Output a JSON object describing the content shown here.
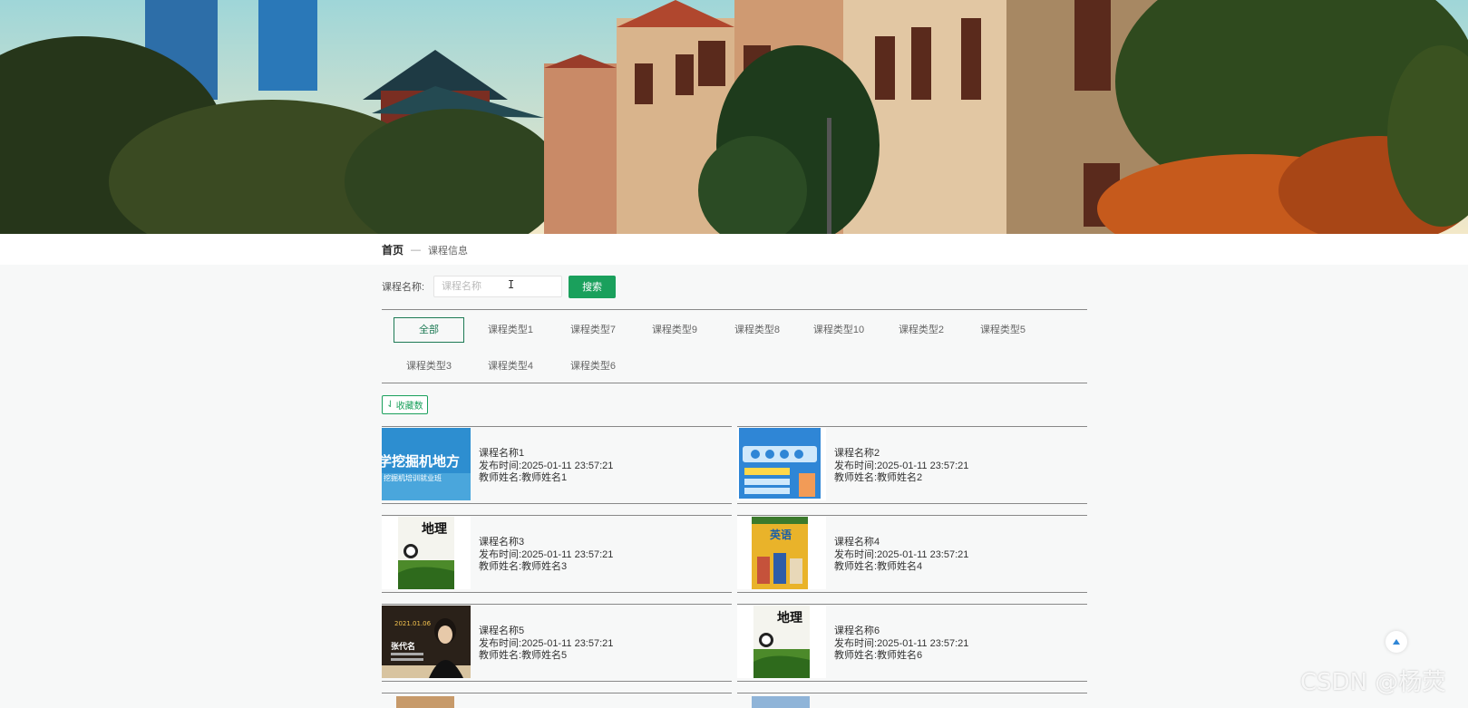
{
  "breadcrumb": {
    "home": "首页",
    "separator": "—",
    "current": "课程信息"
  },
  "search": {
    "label": "课程名称:",
    "placeholder": "课程名称",
    "value": "",
    "button": "搜索"
  },
  "categories": [
    "全部",
    "课程类型1",
    "课程类型7",
    "课程类型9",
    "课程类型8",
    "课程类型10",
    "课程类型2",
    "课程类型5",
    "课程类型3",
    "课程类型4",
    "课程类型6"
  ],
  "favorite_button": "收藏数",
  "courses": [
    {
      "name": "课程名称1",
      "time_label": "发布时间:",
      "time": "2025-01-11 23:57:21",
      "teacher_label": "教师姓名:",
      "teacher": "教师姓名1",
      "thumb_text": "学挖掘机地方",
      "thumb_sub": "挖掘机培训就业班"
    },
    {
      "name": "课程名称2",
      "time_label": "发布时间:",
      "time": "2025-01-11 23:57:21",
      "teacher_label": "教师姓名:",
      "teacher": "教师姓名2"
    },
    {
      "name": "课程名称3",
      "time_label": "发布时间:",
      "time": "2025-01-11 23:57:21",
      "teacher_label": "教师姓名:",
      "teacher": "教师姓名3",
      "thumb_text": "地理"
    },
    {
      "name": "课程名称4",
      "time_label": "发布时间:",
      "time": "2025-01-11 23:57:21",
      "teacher_label": "教师姓名:",
      "teacher": "教师姓名4",
      "thumb_text": "英语"
    },
    {
      "name": "课程名称5",
      "time_label": "发布时间:",
      "time": "2025-01-11 23:57:21",
      "teacher_label": "教师姓名:",
      "teacher": "教师姓名5",
      "thumb_text": "张代名",
      "thumb_sub": "2021.01.06"
    },
    {
      "name": "课程名称6",
      "time_label": "发布时间:",
      "time": "2025-01-11 23:57:21",
      "teacher_label": "教师姓名:",
      "teacher": "教师姓名6",
      "thumb_text": "地理"
    }
  ],
  "watermark": "CSDN @杨荧",
  "colors": {
    "primary": "#1aa05c",
    "active_border": "#1d7a55"
  }
}
